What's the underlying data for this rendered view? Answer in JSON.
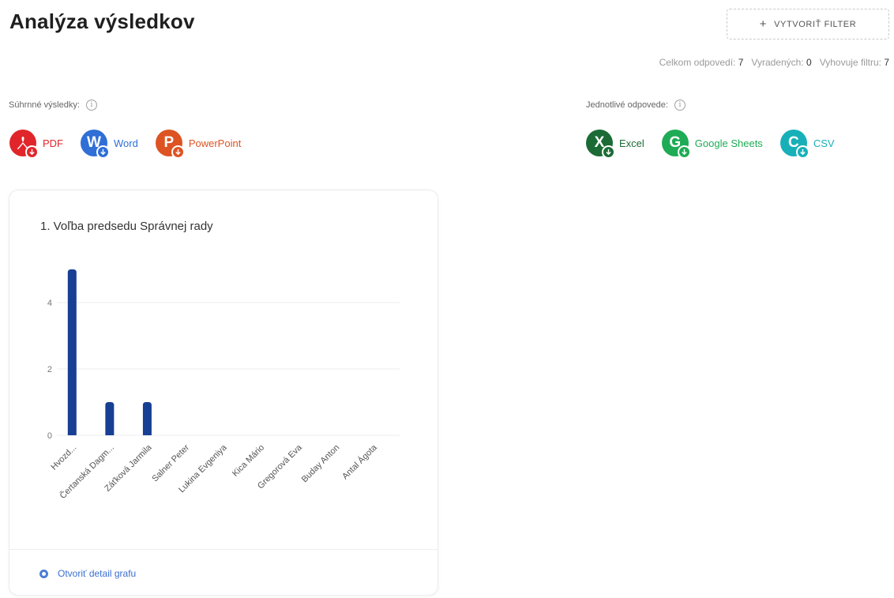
{
  "header": {
    "title": "Analýza výsledkov",
    "create_filter_label": "VYTVORIŤ FILTER"
  },
  "stats": {
    "total_label": "Celkom odpovedí:",
    "total_value": "7",
    "excluded_label": "Vyradených:",
    "excluded_value": "0",
    "matching_label": "Vyhovuje filtru:",
    "matching_value": "7"
  },
  "summary": {
    "label": "Súhrnné výsledky:",
    "exports": [
      {
        "label": "PDF",
        "letter": "",
        "icon": "pdf-icon",
        "color": "#e0262b"
      },
      {
        "label": "Word",
        "letter": "W",
        "icon": "word-icon",
        "color": "#2f6fd6"
      },
      {
        "label": "PowerPoint",
        "letter": "P",
        "icon": "powerpoint-icon",
        "color": "#dd5322"
      }
    ]
  },
  "individual": {
    "label": "Jednotlivé odpovede:",
    "exports": [
      {
        "label": "Excel",
        "letter": "X",
        "icon": "excel-icon",
        "color": "#1c6b36"
      },
      {
        "label": "Google Sheets",
        "letter": "G",
        "icon": "google-sheets-icon",
        "color": "#1eab55"
      },
      {
        "label": "CSV",
        "letter": "C",
        "icon": "csv-icon",
        "color": "#18b0b8"
      }
    ]
  },
  "chart_card": {
    "title": "1. Voľba predsedu Správnej rady",
    "open_detail_label": "Otvoriť detail grafu"
  },
  "chart_data": {
    "type": "bar",
    "categories": [
      "Hvozd...",
      "Čertanská Dagm...",
      "Záťková Jarmila",
      "Salner Peter",
      "Lukina Evgeniya",
      "Kica Mário",
      "Gregorová Eva",
      "Buday Anton",
      "Antal Ágota"
    ],
    "values": [
      5,
      1,
      1,
      0,
      0,
      0,
      0,
      0,
      0
    ],
    "yticks": [
      0,
      2,
      4
    ],
    "ylim": [
      0,
      5
    ],
    "bar_color": "#173f93",
    "grid": true
  }
}
